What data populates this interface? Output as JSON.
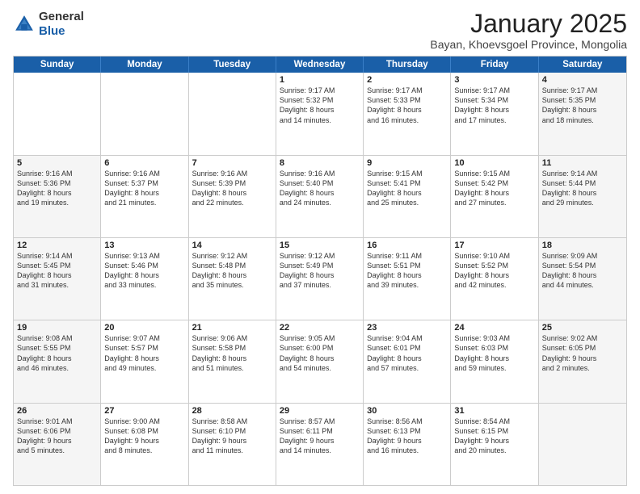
{
  "logo": {
    "general": "General",
    "blue": "Blue"
  },
  "header": {
    "month": "January 2025",
    "location": "Bayan, Khoevsgoel Province, Mongolia"
  },
  "weekdays": [
    "Sunday",
    "Monday",
    "Tuesday",
    "Wednesday",
    "Thursday",
    "Friday",
    "Saturday"
  ],
  "rows": [
    [
      {
        "day": "",
        "lines": [],
        "shaded": false
      },
      {
        "day": "",
        "lines": [],
        "shaded": false
      },
      {
        "day": "",
        "lines": [],
        "shaded": false
      },
      {
        "day": "1",
        "lines": [
          "Sunrise: 9:17 AM",
          "Sunset: 5:32 PM",
          "Daylight: 8 hours",
          "and 14 minutes."
        ],
        "shaded": false
      },
      {
        "day": "2",
        "lines": [
          "Sunrise: 9:17 AM",
          "Sunset: 5:33 PM",
          "Daylight: 8 hours",
          "and 16 minutes."
        ],
        "shaded": false
      },
      {
        "day": "3",
        "lines": [
          "Sunrise: 9:17 AM",
          "Sunset: 5:34 PM",
          "Daylight: 8 hours",
          "and 17 minutes."
        ],
        "shaded": false
      },
      {
        "day": "4",
        "lines": [
          "Sunrise: 9:17 AM",
          "Sunset: 5:35 PM",
          "Daylight: 8 hours",
          "and 18 minutes."
        ],
        "shaded": true
      }
    ],
    [
      {
        "day": "5",
        "lines": [
          "Sunrise: 9:16 AM",
          "Sunset: 5:36 PM",
          "Daylight: 8 hours",
          "and 19 minutes."
        ],
        "shaded": true
      },
      {
        "day": "6",
        "lines": [
          "Sunrise: 9:16 AM",
          "Sunset: 5:37 PM",
          "Daylight: 8 hours",
          "and 21 minutes."
        ],
        "shaded": false
      },
      {
        "day": "7",
        "lines": [
          "Sunrise: 9:16 AM",
          "Sunset: 5:39 PM",
          "Daylight: 8 hours",
          "and 22 minutes."
        ],
        "shaded": false
      },
      {
        "day": "8",
        "lines": [
          "Sunrise: 9:16 AM",
          "Sunset: 5:40 PM",
          "Daylight: 8 hours",
          "and 24 minutes."
        ],
        "shaded": false
      },
      {
        "day": "9",
        "lines": [
          "Sunrise: 9:15 AM",
          "Sunset: 5:41 PM",
          "Daylight: 8 hours",
          "and 25 minutes."
        ],
        "shaded": false
      },
      {
        "day": "10",
        "lines": [
          "Sunrise: 9:15 AM",
          "Sunset: 5:42 PM",
          "Daylight: 8 hours",
          "and 27 minutes."
        ],
        "shaded": false
      },
      {
        "day": "11",
        "lines": [
          "Sunrise: 9:14 AM",
          "Sunset: 5:44 PM",
          "Daylight: 8 hours",
          "and 29 minutes."
        ],
        "shaded": true
      }
    ],
    [
      {
        "day": "12",
        "lines": [
          "Sunrise: 9:14 AM",
          "Sunset: 5:45 PM",
          "Daylight: 8 hours",
          "and 31 minutes."
        ],
        "shaded": true
      },
      {
        "day": "13",
        "lines": [
          "Sunrise: 9:13 AM",
          "Sunset: 5:46 PM",
          "Daylight: 8 hours",
          "and 33 minutes."
        ],
        "shaded": false
      },
      {
        "day": "14",
        "lines": [
          "Sunrise: 9:12 AM",
          "Sunset: 5:48 PM",
          "Daylight: 8 hours",
          "and 35 minutes."
        ],
        "shaded": false
      },
      {
        "day": "15",
        "lines": [
          "Sunrise: 9:12 AM",
          "Sunset: 5:49 PM",
          "Daylight: 8 hours",
          "and 37 minutes."
        ],
        "shaded": false
      },
      {
        "day": "16",
        "lines": [
          "Sunrise: 9:11 AM",
          "Sunset: 5:51 PM",
          "Daylight: 8 hours",
          "and 39 minutes."
        ],
        "shaded": false
      },
      {
        "day": "17",
        "lines": [
          "Sunrise: 9:10 AM",
          "Sunset: 5:52 PM",
          "Daylight: 8 hours",
          "and 42 minutes."
        ],
        "shaded": false
      },
      {
        "day": "18",
        "lines": [
          "Sunrise: 9:09 AM",
          "Sunset: 5:54 PM",
          "Daylight: 8 hours",
          "and 44 minutes."
        ],
        "shaded": true
      }
    ],
    [
      {
        "day": "19",
        "lines": [
          "Sunrise: 9:08 AM",
          "Sunset: 5:55 PM",
          "Daylight: 8 hours",
          "and 46 minutes."
        ],
        "shaded": true
      },
      {
        "day": "20",
        "lines": [
          "Sunrise: 9:07 AM",
          "Sunset: 5:57 PM",
          "Daylight: 8 hours",
          "and 49 minutes."
        ],
        "shaded": false
      },
      {
        "day": "21",
        "lines": [
          "Sunrise: 9:06 AM",
          "Sunset: 5:58 PM",
          "Daylight: 8 hours",
          "and 51 minutes."
        ],
        "shaded": false
      },
      {
        "day": "22",
        "lines": [
          "Sunrise: 9:05 AM",
          "Sunset: 6:00 PM",
          "Daylight: 8 hours",
          "and 54 minutes."
        ],
        "shaded": false
      },
      {
        "day": "23",
        "lines": [
          "Sunrise: 9:04 AM",
          "Sunset: 6:01 PM",
          "Daylight: 8 hours",
          "and 57 minutes."
        ],
        "shaded": false
      },
      {
        "day": "24",
        "lines": [
          "Sunrise: 9:03 AM",
          "Sunset: 6:03 PM",
          "Daylight: 8 hours",
          "and 59 minutes."
        ],
        "shaded": false
      },
      {
        "day": "25",
        "lines": [
          "Sunrise: 9:02 AM",
          "Sunset: 6:05 PM",
          "Daylight: 9 hours",
          "and 2 minutes."
        ],
        "shaded": true
      }
    ],
    [
      {
        "day": "26",
        "lines": [
          "Sunrise: 9:01 AM",
          "Sunset: 6:06 PM",
          "Daylight: 9 hours",
          "and 5 minutes."
        ],
        "shaded": true
      },
      {
        "day": "27",
        "lines": [
          "Sunrise: 9:00 AM",
          "Sunset: 6:08 PM",
          "Daylight: 9 hours",
          "and 8 minutes."
        ],
        "shaded": false
      },
      {
        "day": "28",
        "lines": [
          "Sunrise: 8:58 AM",
          "Sunset: 6:10 PM",
          "Daylight: 9 hours",
          "and 11 minutes."
        ],
        "shaded": false
      },
      {
        "day": "29",
        "lines": [
          "Sunrise: 8:57 AM",
          "Sunset: 6:11 PM",
          "Daylight: 9 hours",
          "and 14 minutes."
        ],
        "shaded": false
      },
      {
        "day": "30",
        "lines": [
          "Sunrise: 8:56 AM",
          "Sunset: 6:13 PM",
          "Daylight: 9 hours",
          "and 16 minutes."
        ],
        "shaded": false
      },
      {
        "day": "31",
        "lines": [
          "Sunrise: 8:54 AM",
          "Sunset: 6:15 PM",
          "Daylight: 9 hours",
          "and 20 minutes."
        ],
        "shaded": false
      },
      {
        "day": "",
        "lines": [],
        "shaded": true
      }
    ]
  ]
}
